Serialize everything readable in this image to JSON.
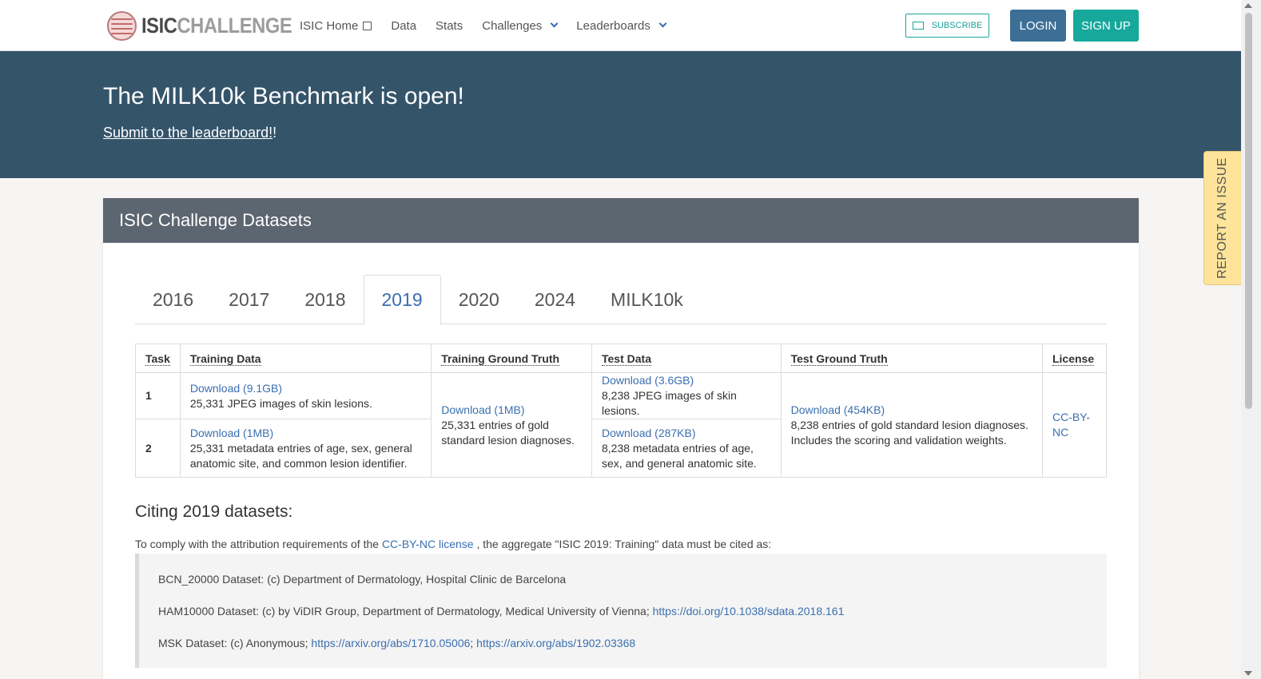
{
  "header": {
    "logo": {
      "part1": "ISIC",
      "part2": "CHALLENGE"
    },
    "nav": [
      {
        "label": "ISIC Home",
        "icon": "external-link-icon"
      },
      {
        "label": "Data"
      },
      {
        "label": "Stats"
      },
      {
        "label": "Challenges",
        "icon": "chevron-down-icon"
      },
      {
        "label": "Leaderboards",
        "icon": "chevron-down-icon"
      }
    ],
    "subscribe": "SUBSCRIBE",
    "login": "LOGIN",
    "signup": "SIGN UP"
  },
  "banner": {
    "title": "The MILK10k Benchmark is open!",
    "link": "Submit to the leaderboard!",
    "suffix": "!"
  },
  "card": {
    "title": "ISIC Challenge Datasets",
    "tabs": [
      "2016",
      "2017",
      "2018",
      "2019",
      "2020",
      "2024",
      "MILK10k"
    ],
    "active_tab": "2019",
    "table": {
      "headers": [
        "Task",
        "Training Data",
        "Training Ground Truth",
        "Test Data",
        "Test Ground Truth",
        "License"
      ],
      "rows": [
        {
          "task": "1",
          "training_link": "Download (9.1GB)",
          "training_desc": "25,331 JPEG images of skin lesions.",
          "test_link": "Download (3.6GB)",
          "test_desc": "8,238 JPEG images of skin lesions."
        },
        {
          "task": "2",
          "training_link": "Download (1MB)",
          "training_desc": "25,331 metadata entries of age, sex, general anatomic site, and common lesion identifier.",
          "test_link": "Download (287KB)",
          "test_desc": "8,238 metadata entries of age, sex, and general anatomic site."
        }
      ],
      "train_gt_link": "Download (1MB)",
      "train_gt_desc": "25,331 entries of gold standard lesion diagnoses.",
      "test_gt_link": "Download (454KB)",
      "test_gt_desc": "8,238 entries of gold standard lesion diagnoses. Includes the scoring and validation weights.",
      "license": "CC-BY-NC"
    },
    "citing": {
      "title": "Citing 2019 datasets:",
      "intro_pre": "To comply with the attribution requirements of the ",
      "intro_link": "CC-BY-NC license",
      "intro_post": " , the aggregate \"ISIC 2019: Training\" data must be cited as:",
      "lines": [
        {
          "text": "BCN_20000 Dataset: (c) Department of Dermatology, Hospital Clinic de Barcelona"
        },
        {
          "text": "HAM10000 Dataset: (c) by ViDIR Group, Department of Dermatology, Medical University of Vienna; ",
          "link1": "https://doi.org/10.1038/sdata.2018.161"
        },
        {
          "text": "MSK Dataset: (c) Anonymous; ",
          "link1": "https://arxiv.org/abs/1710.05006",
          "sep": "; ",
          "link2": "https://arxiv.org/abs/1902.03368"
        }
      ]
    }
  },
  "report_issue": "REPORT AN ISSUE"
}
